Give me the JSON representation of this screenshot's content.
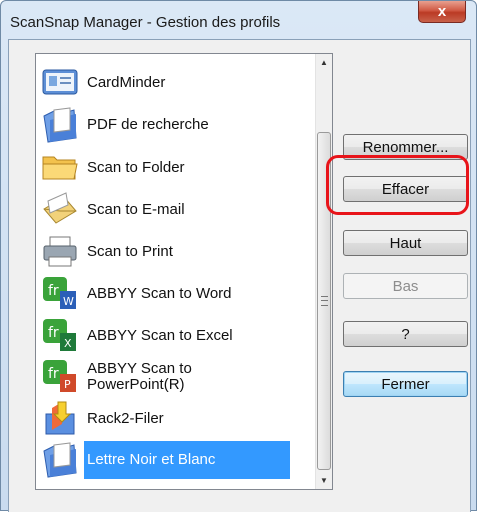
{
  "window": {
    "title": "ScanSnap Manager - Gestion des profils",
    "close_label": "x"
  },
  "profiles": [
    {
      "label": "CardMinder",
      "icon": "cardminder-icon"
    },
    {
      "label": "PDF de recherche",
      "icon": "folder-icon"
    },
    {
      "label": "Scan to Folder",
      "icon": "folder-open-icon"
    },
    {
      "label": "Scan to E-mail",
      "icon": "email-icon"
    },
    {
      "label": "Scan to Print",
      "icon": "printer-icon"
    },
    {
      "label": "ABBYY Scan to Word",
      "icon": "abbyy-word-icon"
    },
    {
      "label": "ABBYY Scan to Excel",
      "icon": "abbyy-excel-icon"
    },
    {
      "label": "ABBYY Scan to\nPowerPoint(R)",
      "icon": "abbyy-powerpoint-icon"
    },
    {
      "label": "Rack2-Filer",
      "icon": "rack2-filer-icon"
    },
    {
      "label": "Lettre Noir et Blanc",
      "icon": "folder-icon",
      "selected": true
    }
  ],
  "buttons": {
    "rename": "Renommer...",
    "delete": "Effacer",
    "up": "Haut",
    "down": "Bas",
    "help": "?",
    "close": "Fermer"
  },
  "colors": {
    "selection": "#3399ff",
    "highlight_ring": "#e8141a"
  }
}
